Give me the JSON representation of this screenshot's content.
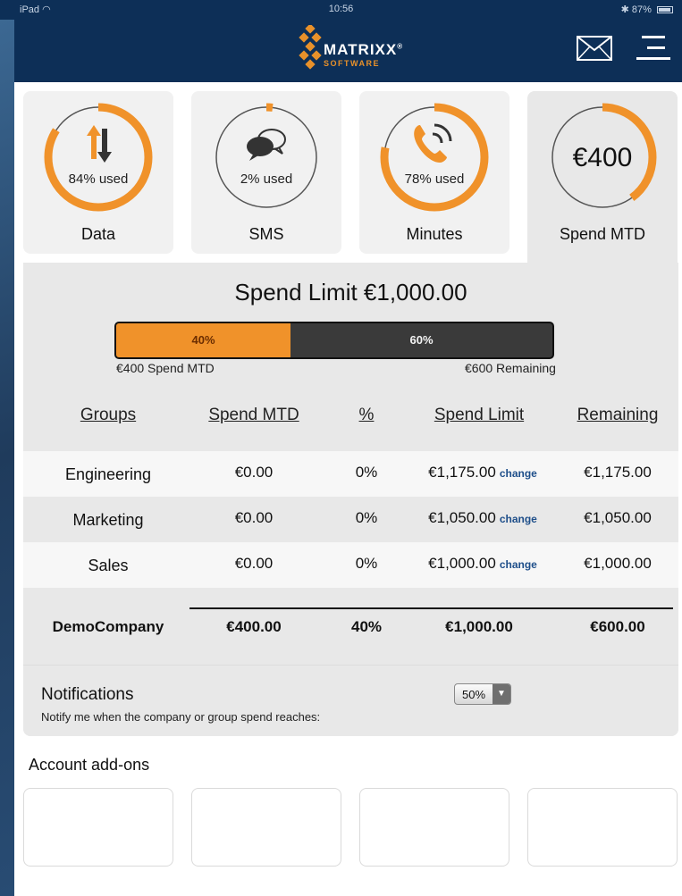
{
  "status_bar": {
    "device": "iPad",
    "time": "10:56",
    "battery": "87%"
  },
  "header": {
    "brand": "MATRIXX",
    "brand_mark": "®",
    "sub_brand": "SOFTWARE",
    "mail_icon": "envelope-icon",
    "menu_icon": "hamburger-menu-icon"
  },
  "colors": {
    "header_bg": "#0d2f57",
    "accent": "#f0922a",
    "link": "#1f4f8a",
    "bar_remaining": "#3a3a3a"
  },
  "tiles": [
    {
      "title": "Data",
      "label": "84% used",
      "used_fraction": 0.84,
      "icon": "data-arrows-icon"
    },
    {
      "title": "SMS",
      "label": "2% used",
      "used_fraction": 0.02,
      "icon": "chat-bubbles-icon"
    },
    {
      "title": "Minutes",
      "label": "78% used",
      "used_fraction": 0.78,
      "icon": "phone-icon"
    },
    {
      "title": "Spend MTD",
      "amount": "€400",
      "used_fraction": 0.4
    }
  ],
  "spend": {
    "title": "Spend Limit €1,000.00",
    "used_label": "40%",
    "remaining_label": "60%",
    "used_fraction": 0.4,
    "used_caption": "€400 Spend MTD",
    "remaining_caption": "€600 Remaining"
  },
  "table": {
    "headers": [
      "Groups",
      "Spend MTD",
      "%",
      "Spend Limit",
      "Remaining"
    ],
    "rows": [
      {
        "group": "Engineering",
        "spend": "€0.00",
        "pct": "0%",
        "limit": "€1,175.00",
        "remaining": "€1,175.00"
      },
      {
        "group": "Marketing",
        "spend": "€0.00",
        "pct": "0%",
        "limit": "€1,050.00",
        "remaining": "€1,050.00"
      },
      {
        "group": "Sales",
        "spend": "€0.00",
        "pct": "0%",
        "limit": "€1,000.00",
        "remaining": "€1,000.00"
      }
    ],
    "change_label": "change",
    "total": {
      "group": "DemoCompany",
      "spend": "€400.00",
      "pct": "40%",
      "limit": "€1,000.00",
      "remaining": "€600.00"
    }
  },
  "notifications": {
    "title": "Notifications",
    "description": "Notify me when the company or group spend reaches:",
    "selected": "50%"
  },
  "addons": {
    "title": "Account add-ons",
    "count_visible": 4
  }
}
